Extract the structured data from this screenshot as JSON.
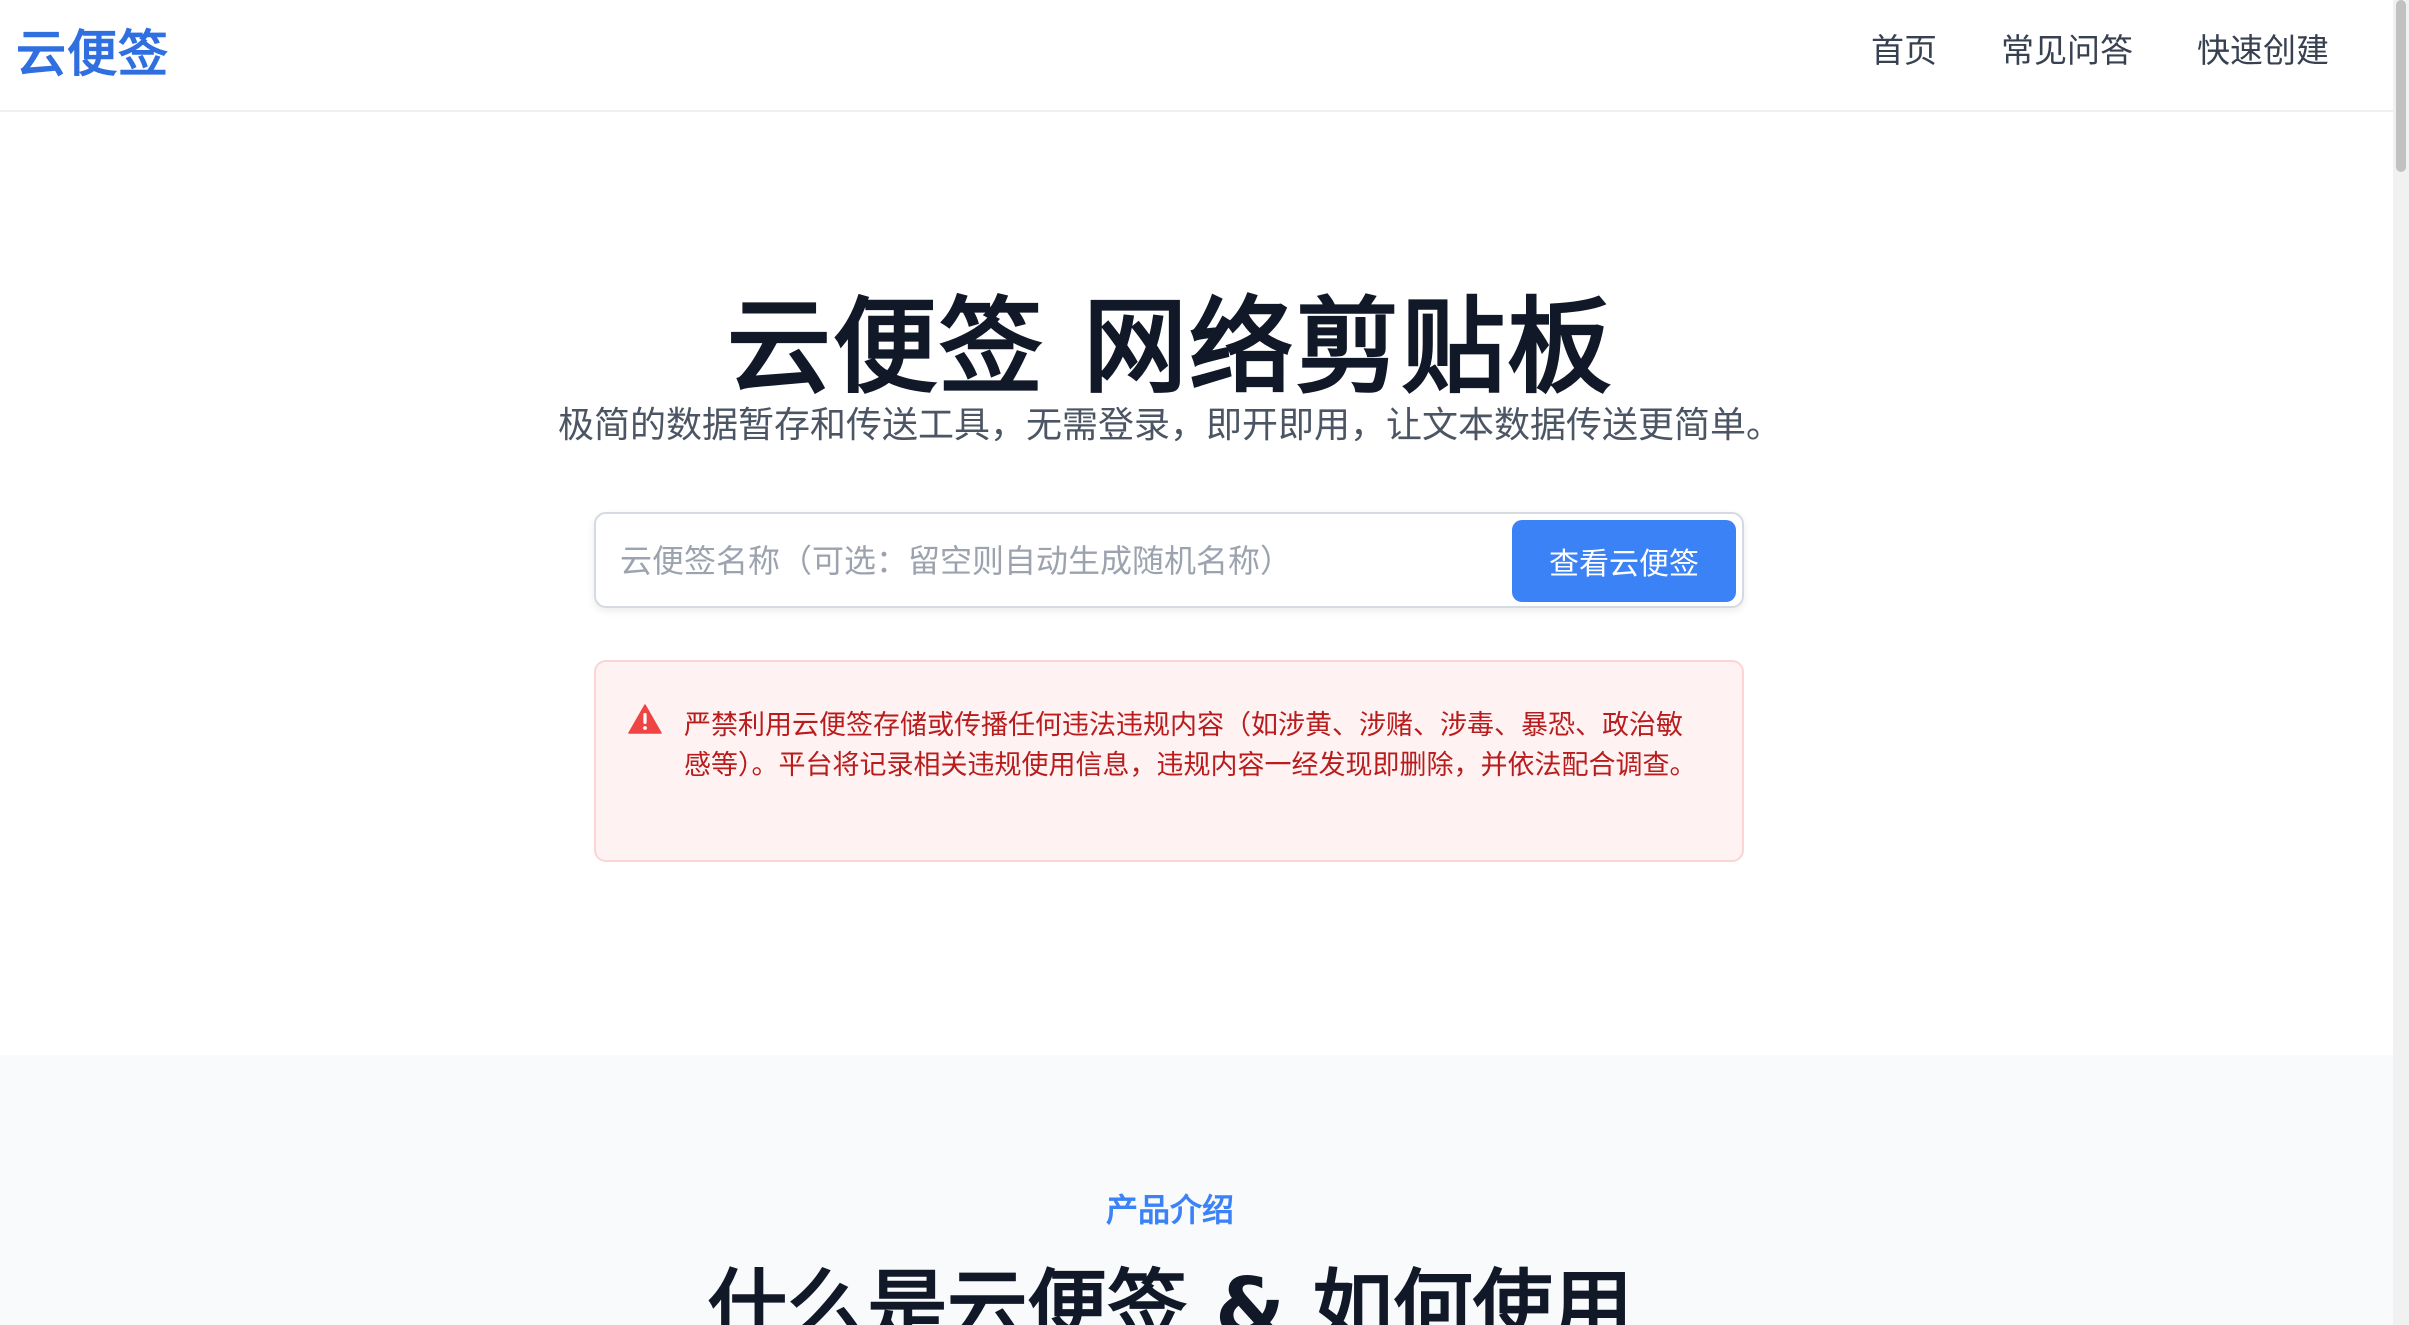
{
  "header": {
    "brand": "云便签",
    "nav": [
      {
        "label": "首页"
      },
      {
        "label": "常见问答"
      },
      {
        "label": "快速创建"
      }
    ]
  },
  "hero": {
    "title": "云便签 网络剪贴板",
    "subtitle": "极简的数据暂存和传送工具，无需登录，即开即用，让文本数据传送更简单。"
  },
  "search": {
    "value": "",
    "placeholder": "云便签名称（可选：留空则自动生成随机名称）",
    "button_label": "查看云便签"
  },
  "warning": {
    "icon": "warning-triangle-icon",
    "text": "严禁利用云便签存储或传播任何违法违规内容（如涉黄、涉赌、涉毒、暴恐、政治敏感等）。平台将记录相关违规使用信息，违规内容一经发现即删除，并依法配合调查。"
  },
  "intro": {
    "label": "产品介绍",
    "title": "什么是云便签 & 如何使用"
  },
  "colors": {
    "brand": "#2f6fe0",
    "accent": "#3b82f6",
    "warning_text": "#b91c1c",
    "warning_bg": "#fef2f2"
  }
}
